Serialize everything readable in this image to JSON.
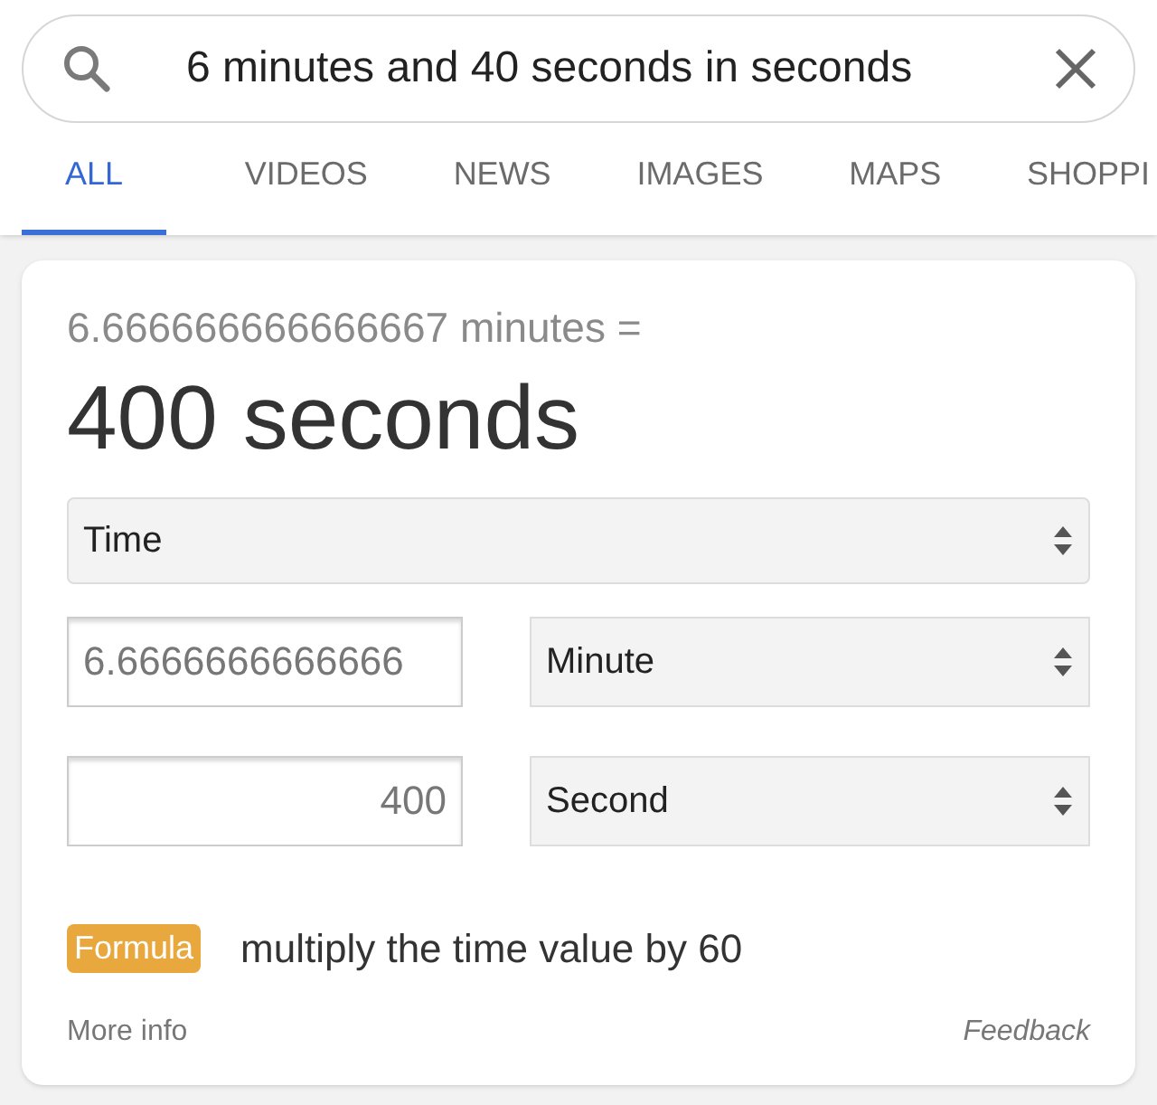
{
  "search": {
    "query": "6 minutes and 40 seconds in seconds"
  },
  "tabs": [
    {
      "label": "ALL",
      "selected": true
    },
    {
      "label": "VIDEOS",
      "selected": false
    },
    {
      "label": "NEWS",
      "selected": false
    },
    {
      "label": "IMAGES",
      "selected": false
    },
    {
      "label": "MAPS",
      "selected": false
    },
    {
      "label": "SHOPPI",
      "selected": false
    }
  ],
  "converter": {
    "equation": "6.666666666666667 minutes =",
    "result": "400 seconds",
    "quantity": "Time",
    "rows": [
      {
        "value": "6.6666666666666",
        "unit": "Minute"
      },
      {
        "value": "400",
        "unit": "Second"
      }
    ],
    "formula_badge": "Formula",
    "formula": "multiply the time value by 60",
    "more_info": "More info",
    "feedback": "Feedback"
  }
}
